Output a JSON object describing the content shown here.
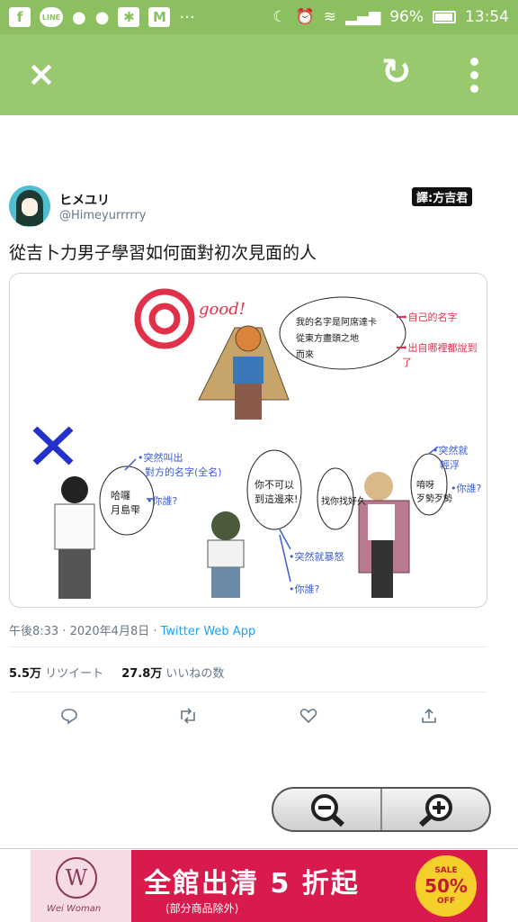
{
  "status_bar": {
    "battery": "96%",
    "time": "13:54",
    "line_label": "LINE"
  },
  "toolbar": {
    "close_icon": "×",
    "reload_icon": "↻"
  },
  "tweet": {
    "display_name": "ヒメユリ",
    "handle": "@Himeyurrrrry",
    "translator_label": "譯:方吉君",
    "text": "從吉卜力男子學習如何面對初次見面的人",
    "comic": {
      "good_label": "good!",
      "speech_top": "我的名字是阿席達卡\n從東方盡頭之地\n而來",
      "note_own_name": "•自己的名字",
      "note_origin": "•出自哪裡都說到了",
      "note_shout_name_1": "•突然叫出",
      "note_shout_name_2": "對方的名字(全名)",
      "note_who_left": "•你誰?",
      "speech_left": "哈囉\n月島雫",
      "speech_middle": "你不可以\n到這邊來!",
      "note_suddenly_angry": "•突然就暴怒",
      "note_who_bottom": "•你誰?",
      "speech_right_a": "找你找好久",
      "speech_right_b": "唷呀\n歹勢歹勢",
      "note_frivolous_1": "•突然就",
      "note_frivolous_2": "輕浮",
      "note_who_right": "•你誰?"
    },
    "meta_time": "午後8:33 · 2020年4月8日 · ",
    "meta_source": "Twitter Web App",
    "retweets_count": "5.5万",
    "retweets_label": "リツイート",
    "likes_count": "27.8万",
    "likes_label": "いいねの数"
  },
  "ad": {
    "logo_letter": "W",
    "brand": "Wei Woman",
    "headline": "全館出清 5 折起",
    "sub": "(部分商品除外)",
    "seal_sale": "SALE",
    "seal_pct": "50%",
    "seal_off": "OFF"
  }
}
